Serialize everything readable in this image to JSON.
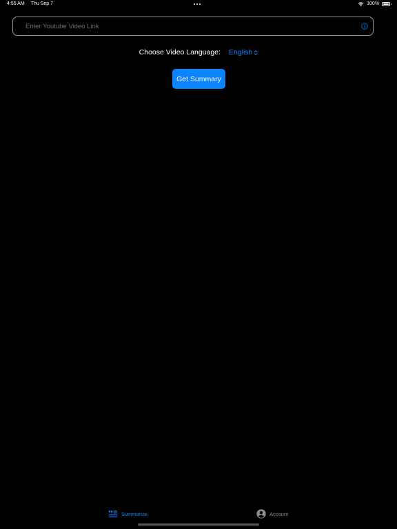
{
  "status_bar": {
    "time": "4:55 AM",
    "date": "Thu Sep 7",
    "battery_text": "100%",
    "battery_level": 1.0,
    "icons": [
      "more-dots-icon",
      "wifi-icon",
      "battery-icon"
    ]
  },
  "link_input": {
    "placeholder": "Enter Youtube Video Link",
    "value": "",
    "icon": "info-icon"
  },
  "language": {
    "label": "Choose Video Language:",
    "selected": "English",
    "icon": "chevron-up-down-icon"
  },
  "summary_button": {
    "label": "Get Summary"
  },
  "tab_bar": {
    "tabs": [
      {
        "label": "Summarize",
        "icon": "quote-list-icon",
        "active": true
      },
      {
        "label": "Account",
        "icon": "person-circle-icon",
        "active": false
      }
    ]
  },
  "colors": {
    "background": "#000000",
    "accent": "#0A84FF",
    "inactive": "#8E8E93",
    "border": "#9A9A9A"
  }
}
